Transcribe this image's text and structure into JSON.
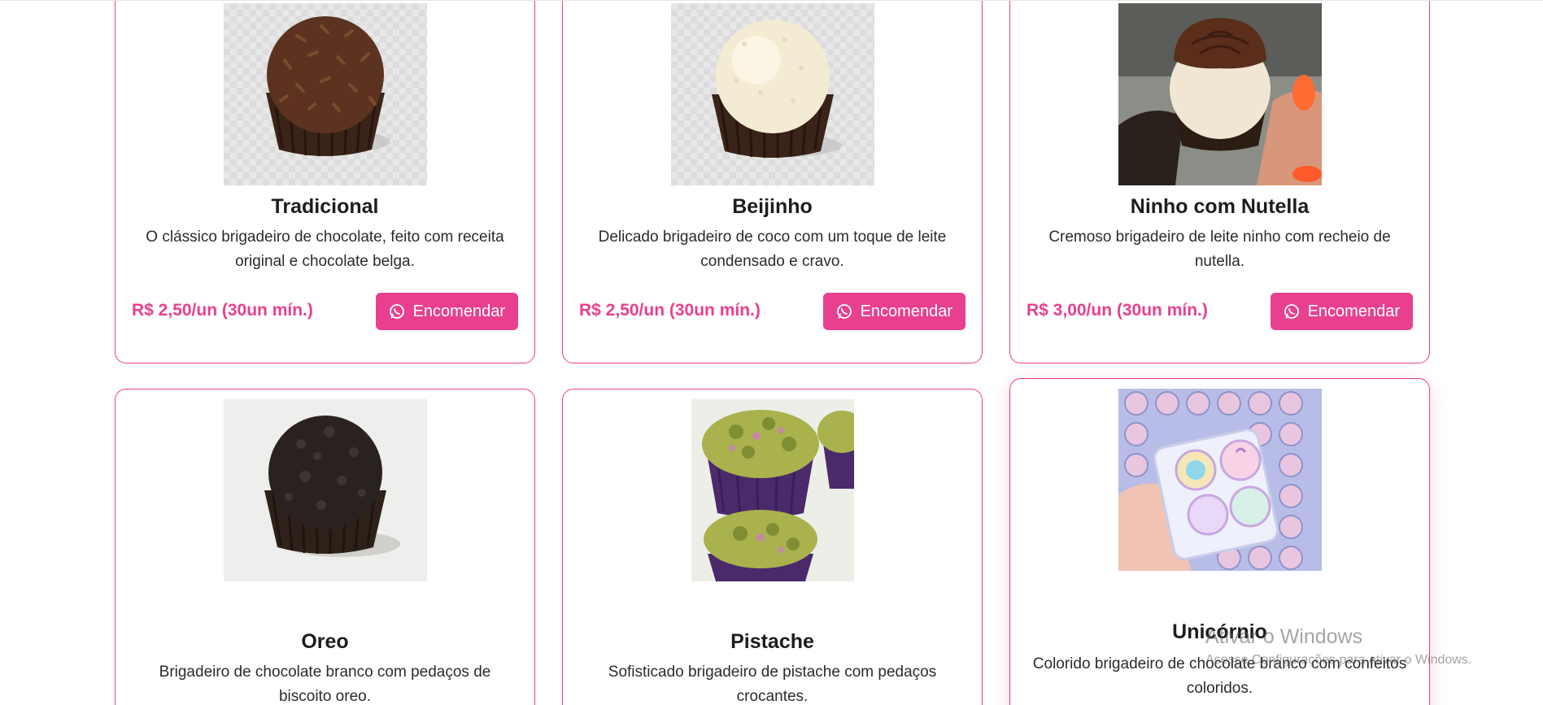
{
  "products": [
    {
      "name": "Tradicional",
      "description": "O clássico brigadeiro de chocolate, feito com receita original e chocolate belga.",
      "price": "R$ 2,50/un (30un mín.)",
      "button": "Encomendar",
      "image": "chocolate-brigadeiro-sprinkles"
    },
    {
      "name": "Beijinho",
      "description": "Delicado brigadeiro de coco com um toque de leite condensado e cravo.",
      "price": "R$ 2,50/un (30un mín.)",
      "button": "Encomendar",
      "image": "coconut-beijinho"
    },
    {
      "name": "Ninho com Nutella",
      "description": "Cremoso brigadeiro de leite ninho com recheio de nutella.",
      "price": "R$ 3,00/un (30un mín.)",
      "button": "Encomendar",
      "image": "ninho-nutella-photo"
    },
    {
      "name": "Oreo",
      "description": "Brigadeiro de chocolate branco com pedaços de biscoito oreo.",
      "image": "oreo-brigadeiro"
    },
    {
      "name": "Pistache",
      "description": "Sofisticado brigadeiro de pistache com pedaços crocantes.",
      "image": "pistachio-brigadeiro-photo"
    },
    {
      "name": "Unicórnio",
      "description": "Colorido brigadeiro de chocolate branco com confeitos coloridos.",
      "image": "unicorn-brigadeiro-box-photo"
    }
  ],
  "colors": {
    "accent": "#e8408e",
    "text": "#212529"
  },
  "icons": {
    "order_button": "whatsapp-icon"
  },
  "watermark": {
    "title": "Ativar o Windows",
    "subtitle": "Acesse Configurações para ativar o Windows."
  }
}
